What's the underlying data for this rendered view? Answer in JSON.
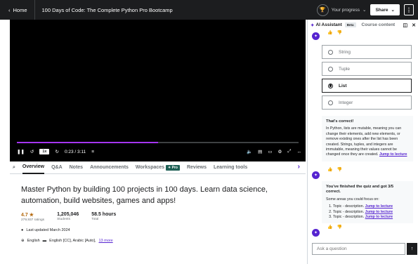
{
  "topbar": {
    "home": "Home",
    "course_title": "100 Days of Code: The Complete Python Pro Bootcamp",
    "progress": "Your progress",
    "share": "Share"
  },
  "player": {
    "speed": "1x",
    "time": "0:23 / 3:11",
    "progress_fraction": 0.5
  },
  "tabs": [
    "Overview",
    "Q&A",
    "Notes",
    "Announcements",
    "Workspaces",
    "Reviews",
    "Learning tools"
  ],
  "tabs_pro_badge": "Pro",
  "course": {
    "headline": "Master Python by building 100 projects in 100 days. Learn data science, automation, build websites, games and apps!",
    "rating": "4.7",
    "ratings_count": "279,937 ratings",
    "students": "1,205,046",
    "students_label": "Students",
    "hours": "58.5 hours",
    "hours_label": "Total",
    "updated": "Last updated March 2024",
    "language": "English",
    "captions": "English [CC], Arabic [Auto],",
    "captions_more": "13 more"
  },
  "ai": {
    "title": "AI Assistant",
    "beta": "Beta",
    "course_content": "Course content",
    "options": [
      "String",
      "Tuple",
      "List",
      "Integer"
    ],
    "selected_option": "List",
    "correct_title": "That's correct!",
    "correct_body": "In Python, lists are mutable, meaning you can change their elements, add new elements, or remove existing ones after the list has been created. Strings, tuples, and integers are immutable, meaning their values cannot be changed once they are created.",
    "jump_link": "Jump to lecture",
    "finished_title": "You've finished the quiz and got 3/5 correct.",
    "focus_intro": "Some areas you could focus on:",
    "topics": [
      "Topic - description.",
      "Topic - description.",
      "Topic - description."
    ],
    "ask_placeholder": "Ask a question"
  },
  "colors": {
    "brand": "#5624d0",
    "topbar": "#1c1d1f",
    "video_progress": "#a435f0",
    "rating": "#b4690e"
  }
}
